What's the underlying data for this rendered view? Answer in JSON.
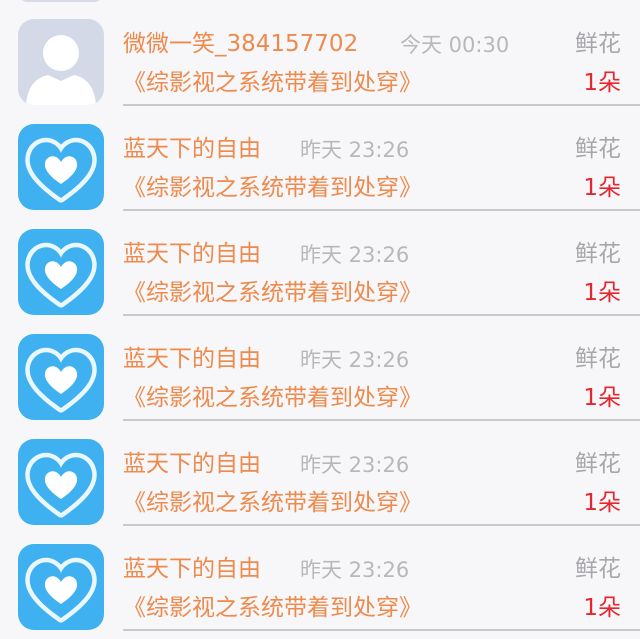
{
  "rows": [
    {
      "name": "微微一笑_384157702",
      "time": "今天 00:30",
      "gift": "鲜花",
      "title": "《综影视之系统带着到处穿》",
      "count": "1朵",
      "avatar": "default-person"
    },
    {
      "name": "蓝天下的自由",
      "time": "昨天 23:26",
      "gift": "鲜花",
      "title": "《综影视之系统带着到处穿》",
      "count": "1朵",
      "avatar": "cloud-heart"
    },
    {
      "name": "蓝天下的自由",
      "time": "昨天 23:26",
      "gift": "鲜花",
      "title": "《综影视之系统带着到处穿》",
      "count": "1朵",
      "avatar": "cloud-heart"
    },
    {
      "name": "蓝天下的自由",
      "time": "昨天 23:26",
      "gift": "鲜花",
      "title": "《综影视之系统带着到处穿》",
      "count": "1朵",
      "avatar": "cloud-heart"
    },
    {
      "name": "蓝天下的自由",
      "time": "昨天 23:26",
      "gift": "鲜花",
      "title": "《综影视之系统带着到处穿》",
      "count": "1朵",
      "avatar": "cloud-heart"
    },
    {
      "name": "蓝天下的自由",
      "time": "昨天 23:26",
      "gift": "鲜花",
      "title": "《综影视之系统带着到处穿》",
      "count": "1朵",
      "avatar": "cloud-heart"
    }
  ],
  "colors": {
    "name": "#ee8a4c",
    "time": "#b8b8bc",
    "gift": "#a7a7ab",
    "count": "#e6262e",
    "background": "#f7f6f8",
    "cloud_heart_sky": "#3fb0f0"
  }
}
